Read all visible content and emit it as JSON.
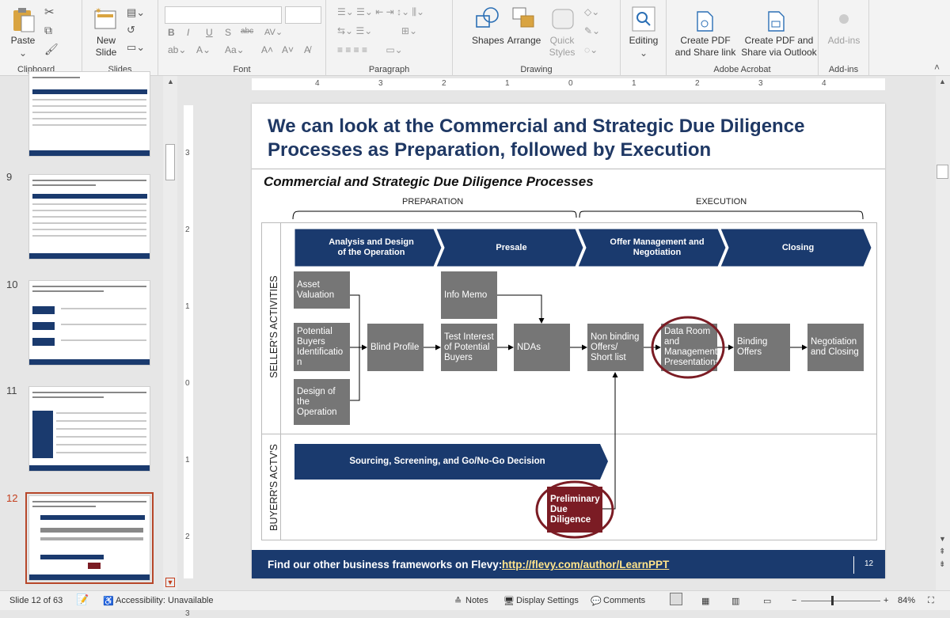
{
  "ribbon": {
    "groups": {
      "clipboard": "Clipboard",
      "slides": "Slides",
      "font": "Font",
      "paragraph": "Paragraph",
      "drawing": "Drawing",
      "acrobat": "Adobe Acrobat",
      "addins": "Add-ins"
    },
    "paste": "Paste",
    "new_slide": "New\nSlide",
    "shapes": "Shapes",
    "arrange": "Arrange",
    "quick_styles": "Quick\nStyles",
    "editing": "Editing",
    "create_pdf_share": "Create PDF\nand Share link",
    "create_pdf_outlook": "Create PDF and\nShare via Outlook",
    "addins_btn": "Add-ins"
  },
  "thumbnails": [
    {
      "num": "",
      "title": "Investment Value Chain"
    },
    {
      "num": "9",
      "title": "Let's take a deeper look into the 2nd phase"
    },
    {
      "num": "10",
      "title": "Initial Screening is comprised of 3 sets of activities"
    },
    {
      "num": "11",
      "title": "The second phase is the First Round Bid"
    },
    {
      "num": "12",
      "title": "We can look at the Commercial and Strategic Due Diligence Processes as Preparation, followed by Execution"
    }
  ],
  "ruler": {
    "h": [
      "4",
      "3",
      "2",
      "1",
      "0",
      "1",
      "2",
      "3",
      "4"
    ],
    "v": [
      "3",
      "2",
      "1",
      "0",
      "1",
      "2",
      "3"
    ]
  },
  "slide": {
    "title": "We can look at the Commercial and Strategic Due Diligence Processes as Preparation, followed by Execution",
    "subtitle": "Commercial and Strategic Due Diligence Processes",
    "preparation": "PREPARATION",
    "execution": "EXECUTION",
    "seller_label": "SELLER'S ACTIVITIES",
    "buyer_label": "BUYERR'S ACTV'S",
    "phases": [
      "Analysis and Design\nof the Operation",
      "Presale",
      "Offer Management and\nNegotiation",
      "Closing"
    ],
    "boxes": {
      "asset": "Asset\nValuation",
      "potential": "Potential\nBuyers\nIdentificatio\nn",
      "design": "Design of\nthe\nOperation",
      "blind": "Blind Profile",
      "info": "Info Memo",
      "test": "Test Interest\nof Potential\nBuyers",
      "ndas": "NDAs",
      "nonbinding": "Non binding\nOffers/\nShort list",
      "dataroom": "Data Room\nand\nManagement\nPresentations",
      "binding": "Binding\nOffers",
      "negotiation": "Negotiation\nand Closing"
    },
    "buyer_arrow": "Sourcing, Screening, and Go/No-Go Decision",
    "prelim": "Preliminary\nDue\nDiligence",
    "footer_text": "Find our other business frameworks on Flevy:",
    "footer_link": "http://flevy.com/author/LearnPPT",
    "page": "12"
  },
  "status": {
    "slide_count": "Slide 12 of 63",
    "accessibility": "Accessibility: Unavailable",
    "notes": "Notes",
    "display": "Display Settings",
    "comments": "Comments",
    "zoom": "84%"
  },
  "colors": {
    "navy": "#1a3a6e",
    "box_gray": "#767676",
    "maroon": "#7b1c24",
    "title_blue": "#1f3864"
  }
}
